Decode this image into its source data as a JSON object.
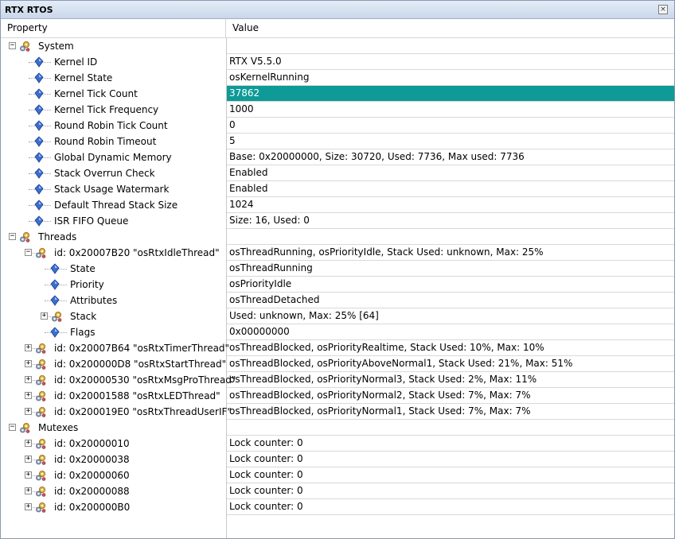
{
  "window": {
    "title": "RTX RTOS",
    "close_glyph": "×"
  },
  "columns": {
    "property": "Property",
    "value": "Value"
  },
  "colors": {
    "highlight": "#0e9a96",
    "grid": "#d9d9d9",
    "titlebar": "#c9d7ea"
  },
  "icons": {
    "group": "gears-icon",
    "property": "blue-diamond-icon",
    "expander": "plus-minus-box-icon"
  },
  "rows": [
    {
      "level": 0,
      "kind": "group",
      "expander": "minus",
      "label": "System",
      "value": ""
    },
    {
      "level": 1,
      "kind": "prop",
      "label": "Kernel ID",
      "value": "RTX V5.5.0"
    },
    {
      "level": 1,
      "kind": "prop",
      "label": "Kernel State",
      "value": "osKernelRunning"
    },
    {
      "level": 1,
      "kind": "prop",
      "label": "Kernel Tick Count",
      "value": "37862",
      "highlight": true
    },
    {
      "level": 1,
      "kind": "prop",
      "label": "Kernel Tick Frequency",
      "value": "1000"
    },
    {
      "level": 1,
      "kind": "prop",
      "label": "Round Robin Tick Count",
      "value": "0"
    },
    {
      "level": 1,
      "kind": "prop",
      "label": "Round Robin Timeout",
      "value": "5"
    },
    {
      "level": 1,
      "kind": "prop",
      "label": "Global Dynamic Memory",
      "value": "Base: 0x20000000, Size: 30720, Used: 7736, Max used: 7736"
    },
    {
      "level": 1,
      "kind": "prop",
      "label": "Stack Overrun Check",
      "value": "Enabled"
    },
    {
      "level": 1,
      "kind": "prop",
      "label": "Stack Usage Watermark",
      "value": "Enabled"
    },
    {
      "level": 1,
      "kind": "prop",
      "label": "Default Thread Stack Size",
      "value": "1024"
    },
    {
      "level": 1,
      "kind": "prop",
      "label": "ISR FIFO Queue",
      "value": "Size: 16, Used: 0"
    },
    {
      "level": 0,
      "kind": "group",
      "expander": "minus",
      "label": "Threads",
      "value": ""
    },
    {
      "level": 1,
      "kind": "group",
      "expander": "minus",
      "label": "id: 0x20007B20 \"osRtxIdleThread\"",
      "value": "osThreadRunning, osPriorityIdle, Stack Used: unknown, Max: 25%"
    },
    {
      "level": 2,
      "kind": "prop",
      "label": "State",
      "value": "osThreadRunning"
    },
    {
      "level": 2,
      "kind": "prop",
      "label": "Priority",
      "value": "osPriorityIdle"
    },
    {
      "level": 2,
      "kind": "prop",
      "label": "Attributes",
      "value": "osThreadDetached"
    },
    {
      "level": 2,
      "kind": "group",
      "expander": "plus",
      "label": "Stack",
      "value": "Used: unknown, Max: 25% [64]"
    },
    {
      "level": 2,
      "kind": "prop",
      "label": "Flags",
      "value": "0x00000000"
    },
    {
      "level": 1,
      "kind": "group",
      "expander": "plus",
      "label": "id: 0x20007B64 \"osRtxTimerThread\"",
      "value": "osThreadBlocked, osPriorityRealtime, Stack Used: 10%, Max: 10%"
    },
    {
      "level": 1,
      "kind": "group",
      "expander": "plus",
      "label": "id: 0x200000D8 \"osRtxStartThread\"",
      "value": "osThreadBlocked, osPriorityAboveNormal1, Stack Used: 21%, Max: 51%"
    },
    {
      "level": 1,
      "kind": "group",
      "expander": "plus",
      "label": "id: 0x20000530 \"osRtxMsgProThread\"",
      "value": "osThreadBlocked, osPriorityNormal3, Stack Used: 2%, Max: 11%"
    },
    {
      "level": 1,
      "kind": "group",
      "expander": "plus",
      "label": "id: 0x20001588 \"osRtxLEDThread\"",
      "value": "osThreadBlocked, osPriorityNormal2, Stack Used: 7%, Max: 7%"
    },
    {
      "level": 1,
      "kind": "group",
      "expander": "plus",
      "label": "id: 0x200019E0 \"osRtxThreadUserIF\"",
      "value": "osThreadBlocked, osPriorityNormal1, Stack Used: 7%, Max: 7%"
    },
    {
      "level": 0,
      "kind": "group",
      "expander": "minus",
      "label": "Mutexes",
      "value": ""
    },
    {
      "level": 1,
      "kind": "group",
      "expander": "plus",
      "label": "id: 0x20000010",
      "value": "Lock counter: 0"
    },
    {
      "level": 1,
      "kind": "group",
      "expander": "plus",
      "label": "id: 0x20000038",
      "value": "Lock counter: 0"
    },
    {
      "level": 1,
      "kind": "group",
      "expander": "plus",
      "label": "id: 0x20000060",
      "value": "Lock counter: 0"
    },
    {
      "level": 1,
      "kind": "group",
      "expander": "plus",
      "label": "id: 0x20000088",
      "value": "Lock counter: 0"
    },
    {
      "level": 1,
      "kind": "group",
      "expander": "plus",
      "label": "id: 0x200000B0",
      "value": "Lock counter: 0"
    }
  ]
}
